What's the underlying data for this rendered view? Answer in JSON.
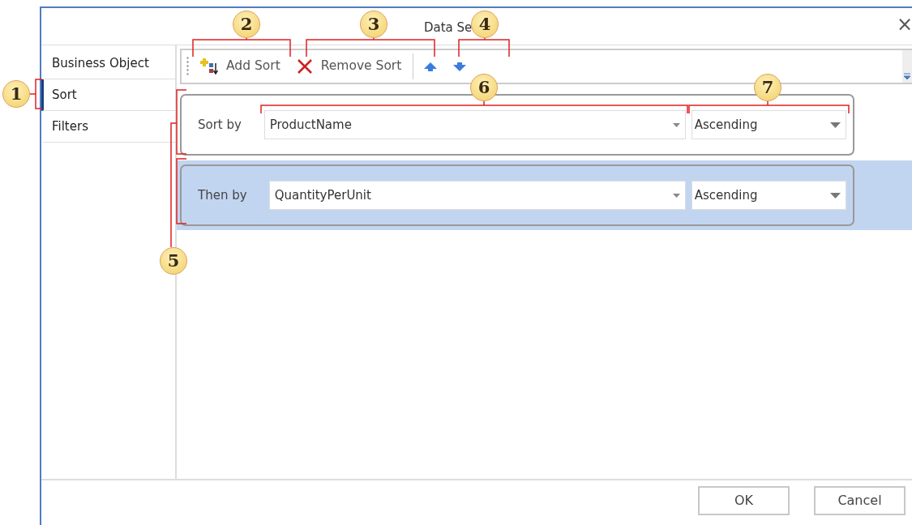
{
  "window": {
    "title": "Data Se",
    "close": "×"
  },
  "sidebar": {
    "items": [
      {
        "label": "Business Object",
        "selected": false
      },
      {
        "label": "Sort",
        "selected": true
      },
      {
        "label": "Filters",
        "selected": false
      }
    ]
  },
  "toolbar": {
    "buttons": [
      {
        "kind": "add",
        "label": "Add Sort"
      },
      {
        "kind": "remove",
        "label": "Remove Sort"
      },
      {
        "kind": "up"
      },
      {
        "kind": "down"
      }
    ]
  },
  "sort_rows": [
    {
      "label": "Sort by",
      "field": "ProductName",
      "order": "Ascending",
      "selected": false
    },
    {
      "label": "Then by",
      "field": "QuantityPerUnit",
      "order": "Ascending",
      "selected": true
    }
  ],
  "footer": {
    "buttons": [
      "OK",
      "Cancel"
    ]
  },
  "callouts": [
    "1",
    "2",
    "3",
    "4",
    "5",
    "6",
    "7"
  ]
}
